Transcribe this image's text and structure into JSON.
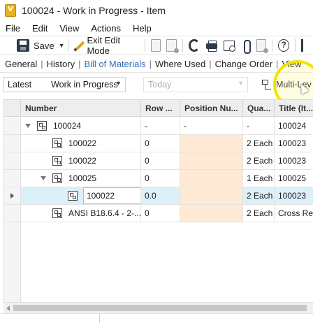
{
  "window": {
    "title": "100024 - Work in Progress - Item"
  },
  "menu": [
    "File",
    "Edit",
    "View",
    "Actions",
    "Help"
  ],
  "toolbar": {
    "save_label": "Save",
    "edit_mode_label": "Exit Edit Mode"
  },
  "tabs": [
    {
      "label": "General",
      "active": false
    },
    {
      "label": "History",
      "active": false
    },
    {
      "label": "Bill of Materials",
      "active": true
    },
    {
      "label": "Where Used",
      "active": false
    },
    {
      "label": "Change Order",
      "active": false
    },
    {
      "label": "View",
      "active": false
    }
  ],
  "filters": {
    "version": "Latest",
    "state": "Work in Progress",
    "date": "Today",
    "level": "Multi-Lev"
  },
  "grid": {
    "columns": [
      "Number",
      "Row ...",
      "Position Nu...",
      "Qua...",
      "Title (It..."
    ],
    "rows": [
      {
        "number": "100024",
        "row": "-",
        "position": "-",
        "qty": "-",
        "title": "100024"
      },
      {
        "number": "100022",
        "row": "0",
        "position": "",
        "qty": "2 Each",
        "title": "100023"
      },
      {
        "number": "100022",
        "row": "0",
        "position": "",
        "qty": "2 Each",
        "title": "100023"
      },
      {
        "number": "100025",
        "row": "0",
        "position": "",
        "qty": "1 Each",
        "title": "100025"
      },
      {
        "number": "100022",
        "row": "0.0",
        "position": "",
        "qty": "2 Each",
        "title": "100023"
      },
      {
        "number": "ANSI B18.6.4 - 2-...",
        "row": "0",
        "position": "",
        "qty": "2 Each",
        "title": "Cross Rec"
      }
    ]
  },
  "colors": {
    "accent": "#2f6fb7",
    "position_fill": "#fde9d4",
    "selected_row": "#dcf0fa",
    "highlight": "#f0e400"
  }
}
